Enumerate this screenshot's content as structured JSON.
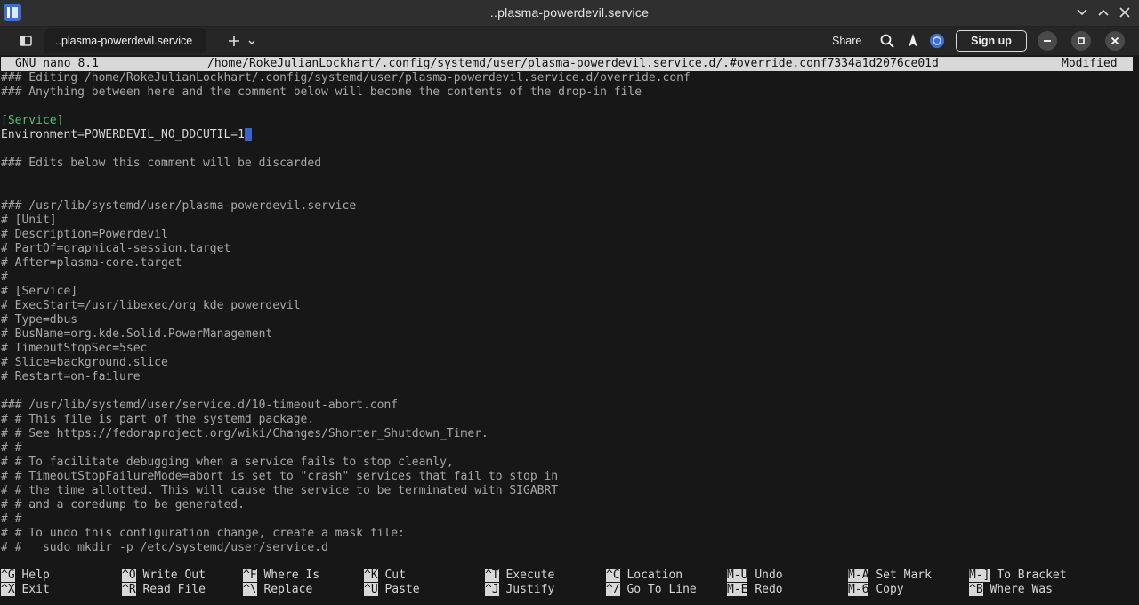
{
  "window": {
    "title": "..plasma-powerdevil.service"
  },
  "tabbar": {
    "tab_label": "..plasma-powerdevil.service",
    "share_label": "Share",
    "signup_label": "Sign up"
  },
  "nano": {
    "version": "GNU nano 8.1",
    "path": "/home/RokeJulianLockhart/.config/systemd/user/plasma-powerdevil.service.d/.#override.conf7334a1d2076ce01d",
    "status": "Modified"
  },
  "editor": {
    "lines": [
      {
        "text": "### Editing /home/RokeJulianLockhart/.config/systemd/user/plasma-powerdevil.service.d/override.conf",
        "style": "comment"
      },
      {
        "text": "### Anything between here and the comment below will become the contents of the drop-in file",
        "style": "comment"
      },
      {
        "text": "",
        "style": "comment"
      },
      {
        "text": "[Service]",
        "style": "green"
      },
      {
        "text": "Environment=POWERDEVIL_NO_DDCUTIL=1",
        "style": "norm",
        "cursor": true
      },
      {
        "text": "",
        "style": "comment"
      },
      {
        "text": "### Edits below this comment will be discarded",
        "style": "comment"
      },
      {
        "text": "",
        "style": "comment"
      },
      {
        "text": "",
        "style": "comment"
      },
      {
        "text": "### /usr/lib/systemd/user/plasma-powerdevil.service",
        "style": "comment"
      },
      {
        "text": "# [Unit]",
        "style": "comment"
      },
      {
        "text": "# Description=Powerdevil",
        "style": "comment"
      },
      {
        "text": "# PartOf=graphical-session.target",
        "style": "comment"
      },
      {
        "text": "# After=plasma-core.target",
        "style": "comment"
      },
      {
        "text": "#",
        "style": "comment"
      },
      {
        "text": "# [Service]",
        "style": "comment"
      },
      {
        "text": "# ExecStart=/usr/libexec/org_kde_powerdevil",
        "style": "comment"
      },
      {
        "text": "# Type=dbus",
        "style": "comment"
      },
      {
        "text": "# BusName=org.kde.Solid.PowerManagement",
        "style": "comment"
      },
      {
        "text": "# TimeoutStopSec=5sec",
        "style": "comment"
      },
      {
        "text": "# Slice=background.slice",
        "style": "comment"
      },
      {
        "text": "# Restart=on-failure",
        "style": "comment"
      },
      {
        "text": "",
        "style": "comment"
      },
      {
        "text": "### /usr/lib/systemd/user/service.d/10-timeout-abort.conf",
        "style": "comment"
      },
      {
        "text": "# # This file is part of the systemd package.",
        "style": "comment"
      },
      {
        "text": "# # See https://fedoraproject.org/wiki/Changes/Shorter_Shutdown_Timer.",
        "style": "comment"
      },
      {
        "text": "# #",
        "style": "comment"
      },
      {
        "text": "# # To facilitate debugging when a service fails to stop cleanly,",
        "style": "comment"
      },
      {
        "text": "# # TimeoutStopFailureMode=abort is set to \"crash\" services that fail to stop in",
        "style": "comment"
      },
      {
        "text": "# # the time allotted. This will cause the service to be terminated with SIGABRT",
        "style": "comment"
      },
      {
        "text": "# # and a coredump to be generated.",
        "style": "comment"
      },
      {
        "text": "# #",
        "style": "comment"
      },
      {
        "text": "# # To undo this configuration change, create a mask file:",
        "style": "comment"
      },
      {
        "text": "# #   sudo mkdir -p /etc/systemd/user/service.d",
        "style": "comment"
      }
    ]
  },
  "shortcuts": {
    "row1": [
      {
        "key": "^G",
        "label": "Help"
      },
      {
        "key": "^O",
        "label": "Write Out"
      },
      {
        "key": "^F",
        "label": "Where Is"
      },
      {
        "key": "^K",
        "label": "Cut"
      },
      {
        "key": "^T",
        "label": "Execute"
      },
      {
        "key": "^C",
        "label": "Location"
      },
      {
        "key": "M-U",
        "label": "Undo"
      },
      {
        "key": "M-A",
        "label": "Set Mark"
      },
      {
        "key": "M-]",
        "label": "To Bracket"
      }
    ],
    "row2": [
      {
        "key": "^X",
        "label": "Exit"
      },
      {
        "key": "^R",
        "label": "Read File"
      },
      {
        "key": "^\\",
        "label": "Replace"
      },
      {
        "key": "^U",
        "label": "Paste"
      },
      {
        "key": "^J",
        "label": "Justify"
      },
      {
        "key": "^/",
        "label": "Go To Line"
      },
      {
        "key": "M-E",
        "label": "Redo"
      },
      {
        "key": "M-6",
        "label": "Copy"
      },
      {
        "key": "^B",
        "label": "Where Was"
      }
    ]
  }
}
